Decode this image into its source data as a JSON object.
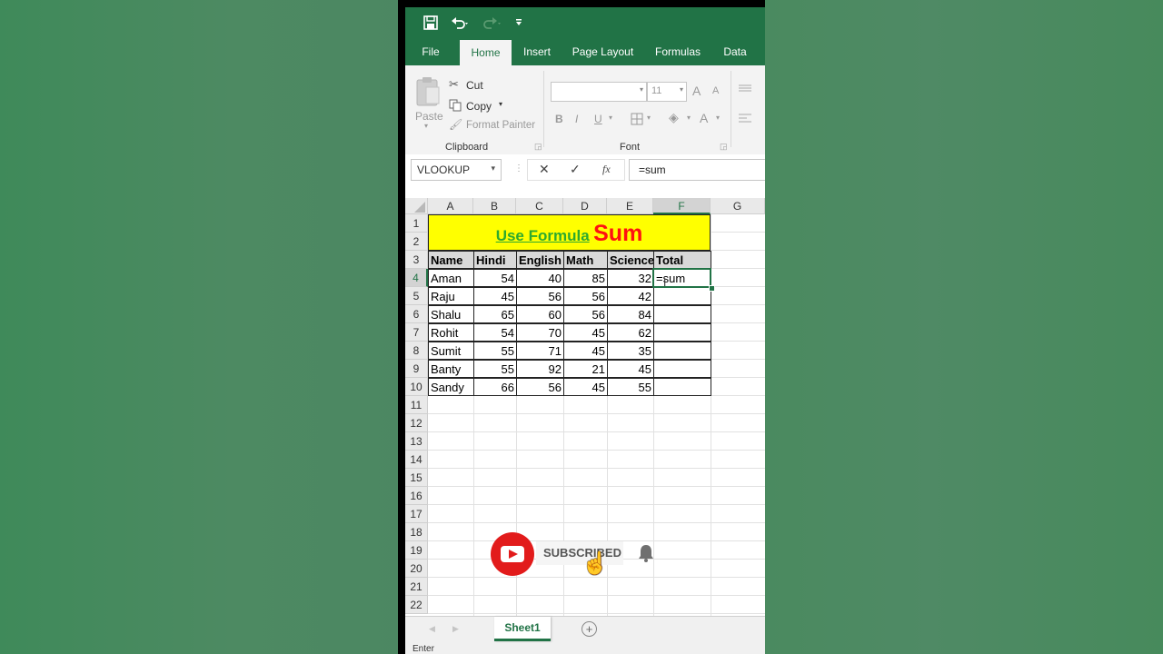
{
  "qat": {
    "save_icon": "save-icon",
    "undo_icon": "undo-icon",
    "redo_icon": "redo-icon",
    "customize_icon": "customize-qat-icon"
  },
  "tabs": [
    "File",
    "Home",
    "Insert",
    "Page Layout",
    "Formulas",
    "Data"
  ],
  "active_tab": "Home",
  "ribbon": {
    "clipboard": {
      "paste": "Paste",
      "cut": "Cut",
      "copy": "Copy",
      "format_painter": "Format Painter",
      "group_label": "Clipboard"
    },
    "font": {
      "font_name": "",
      "font_size": "11",
      "bold": "B",
      "italic": "I",
      "underline": "U",
      "grow": "A",
      "shrink": "A",
      "group_label": "Font"
    }
  },
  "formula_bar": {
    "name_box": "VLOOKUP",
    "cancel": "✕",
    "enter": "✓",
    "fx": "fx",
    "formula": "=sum"
  },
  "columns": [
    "A",
    "B",
    "C",
    "D",
    "E",
    "F",
    "G"
  ],
  "selected_column": "F",
  "rows": [
    "1",
    "2",
    "3",
    "4",
    "5",
    "6",
    "7",
    "8",
    "9",
    "10",
    "11",
    "12",
    "13",
    "14",
    "15",
    "16",
    "17",
    "18",
    "19",
    "20",
    "21",
    "22"
  ],
  "selected_row": "4",
  "title_banner": {
    "part1": "Use Formula",
    "part2": "Sum"
  },
  "table": {
    "headers": [
      "Name",
      "Hindi",
      "English",
      "Math",
      "Science",
      "Total"
    ],
    "rows": [
      [
        "Aman",
        "54",
        "40",
        "85",
        "32",
        "=sum"
      ],
      [
        "Raju",
        "45",
        "56",
        "56",
        "42",
        ""
      ],
      [
        "Shalu",
        "65",
        "60",
        "56",
        "84",
        ""
      ],
      [
        "Rohit",
        "54",
        "70",
        "45",
        "62",
        ""
      ],
      [
        "Sumit",
        "55",
        "71",
        "45",
        "35",
        ""
      ],
      [
        "Banty",
        "55",
        "92",
        "21",
        "45",
        ""
      ],
      [
        "Sandy",
        "66",
        "56",
        "45",
        "55",
        ""
      ]
    ]
  },
  "sheet_tab": "Sheet1",
  "add_sheet": "+",
  "status": "Enter",
  "subscribe": {
    "label": "SUBSCRIBED",
    "colors": {
      "red": "#e21b1b"
    }
  },
  "colors": {
    "excel_green": "#217346",
    "banner_yellow": "#ffff00",
    "banner_green": "#2eaa2e",
    "banner_red": "#ff1111"
  }
}
